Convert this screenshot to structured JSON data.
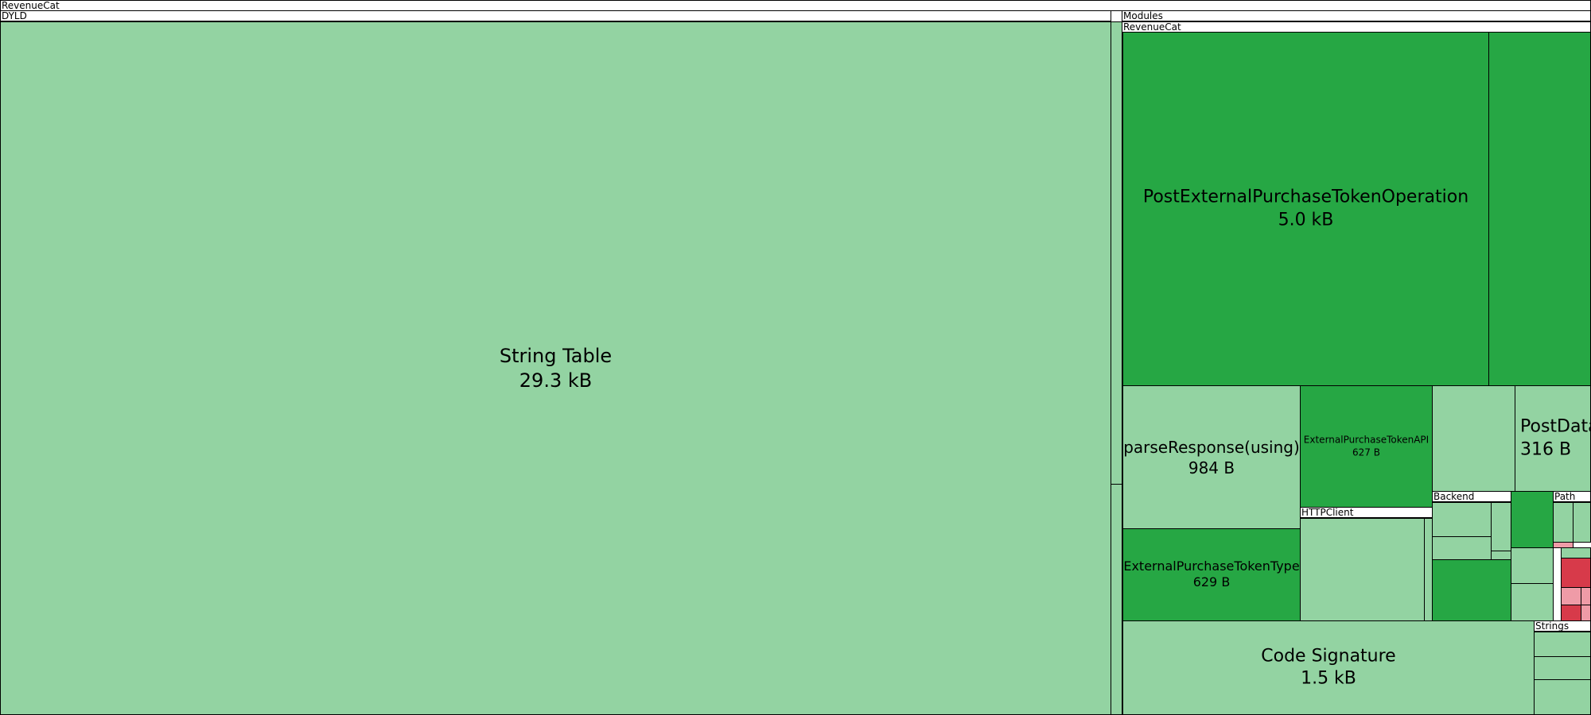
{
  "root": {
    "label": "RevenueCat"
  },
  "dyld": {
    "label": "DYLD"
  },
  "modules": {
    "label": "Modules"
  },
  "revenuecat_module": {
    "label": "RevenueCat"
  },
  "cells": {
    "string_table": {
      "name": "String Table",
      "size": "29.3 kB"
    },
    "post_external_purchase_token_operation": {
      "name": "PostExternalPurchaseTokenOperation",
      "size": "5.0 kB"
    },
    "parse_response": {
      "name": "parseResponse(using)",
      "size": "984 B"
    },
    "external_purchase_token_api": {
      "name": "ExternalPurchaseTokenAPI",
      "size": "627 B"
    },
    "post_data": {
      "name": "PostData",
      "size": "316 B"
    },
    "external_purchase_token_type": {
      "name": "ExternalPurchaseTokenType",
      "size": "629 B"
    },
    "code_signature": {
      "name": "Code Signature",
      "size": "1.5 kB"
    }
  },
  "groups": {
    "http_client": {
      "label": "HTTPClient"
    },
    "backend": {
      "label": "Backend"
    },
    "path": {
      "label": "Path"
    },
    "strings": {
      "label": "Strings"
    }
  },
  "colors": {
    "light_green": "#93d3a2",
    "dark_green": "#26a744",
    "red": "#d73a4a",
    "pink": "#ef9ba7"
  }
}
